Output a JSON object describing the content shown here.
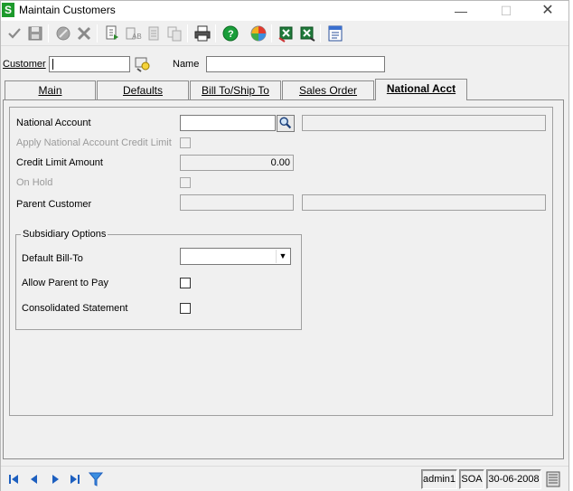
{
  "window": {
    "title": "Maintain Customers",
    "app_icon_letter": "S"
  },
  "toolbar": {
    "icons": [
      "accept-icon",
      "save-icon",
      "cancel-icon",
      "delete-icon",
      "copy-icon",
      "rename-icon",
      "notes-icon",
      "paste-icon",
      "print-icon",
      "help-icon",
      "color-icon",
      "excel-export-icon",
      "excel-icon",
      "memo-icon"
    ]
  },
  "header": {
    "customer_label": "Customer",
    "customer_value": "",
    "name_label": "Name",
    "name_value": ""
  },
  "tabs": [
    {
      "label": "Main",
      "active": false
    },
    {
      "label": "Defaults",
      "active": false
    },
    {
      "label": "Bill To/Ship To",
      "active": false
    },
    {
      "label": "Sales Order",
      "active": false
    },
    {
      "label": "National Acct",
      "active": true
    }
  ],
  "national": {
    "national_account_label": "National Account",
    "national_account_value": "",
    "national_account_desc": "",
    "apply_credit_limit_label": "Apply National Account Credit Limit",
    "credit_limit_label": "Credit Limit Amount",
    "credit_limit_value": "0.00",
    "on_hold_label": "On Hold",
    "parent_customer_label": "Parent Customer",
    "parent_customer_value": "",
    "parent_customer_desc": ""
  },
  "subsidiary": {
    "title": "Subsidiary Options",
    "default_bill_to_label": "Default Bill-To",
    "default_bill_to_value": "",
    "allow_parent_pay_label": "Allow Parent to Pay",
    "consolidated_statement_label": "Consolidated Statement"
  },
  "statusbar": {
    "user": "admin1",
    "company": "SOA",
    "date": "30-06-2008"
  },
  "colors": {
    "app_icon": "#1d9a2c",
    "background": "#f0f0f0"
  }
}
